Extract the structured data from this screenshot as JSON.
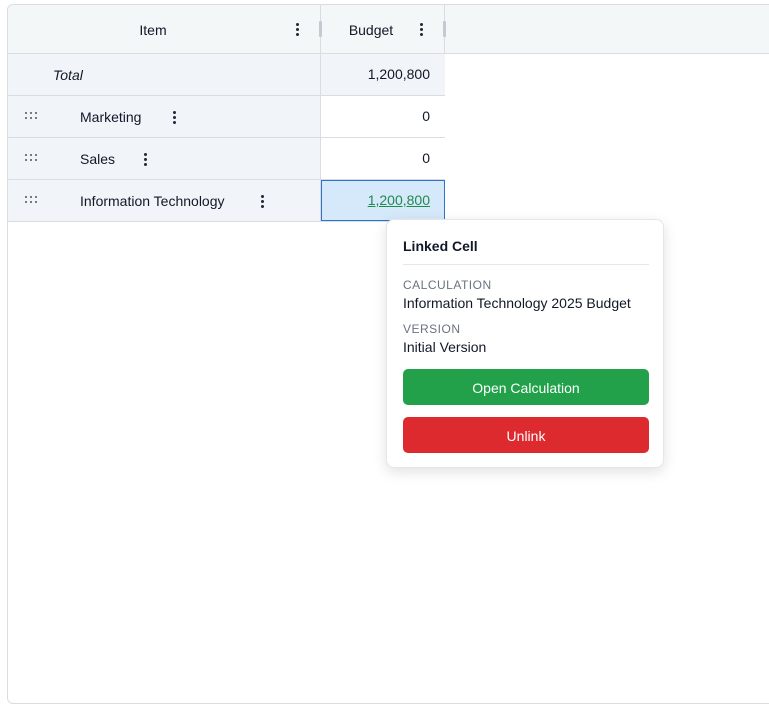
{
  "grid": {
    "columns": {
      "item": "Item",
      "budget": "Budget"
    },
    "total": {
      "label": "Total",
      "budget": "1,200,800"
    },
    "rows": [
      {
        "label": "Marketing",
        "budget": "0"
      },
      {
        "label": "Sales",
        "budget": "0"
      },
      {
        "label": "Information Technology",
        "budget": "1,200,800"
      }
    ]
  },
  "popover": {
    "title": "Linked Cell",
    "calculation_label": "CALCULATION",
    "calculation_value": "Information Technology 2025 Budget",
    "version_label": "VERSION",
    "version_value": "Initial Version",
    "open_button": "Open Calculation",
    "unlink_button": "Unlink"
  },
  "icons": {
    "column_menu": "kebab-menu-icon",
    "row_menu": "kebab-menu-icon",
    "drag_handle": "drag-handle-icon"
  },
  "colors": {
    "header_bg": "#f3f7f8",
    "row_bg": "#f1f4f8",
    "linked_cell_bg": "#d6e9fb",
    "linked_text": "#1f8a4c",
    "open_button": "#22a14a",
    "unlink_button": "#dc2a2f"
  }
}
